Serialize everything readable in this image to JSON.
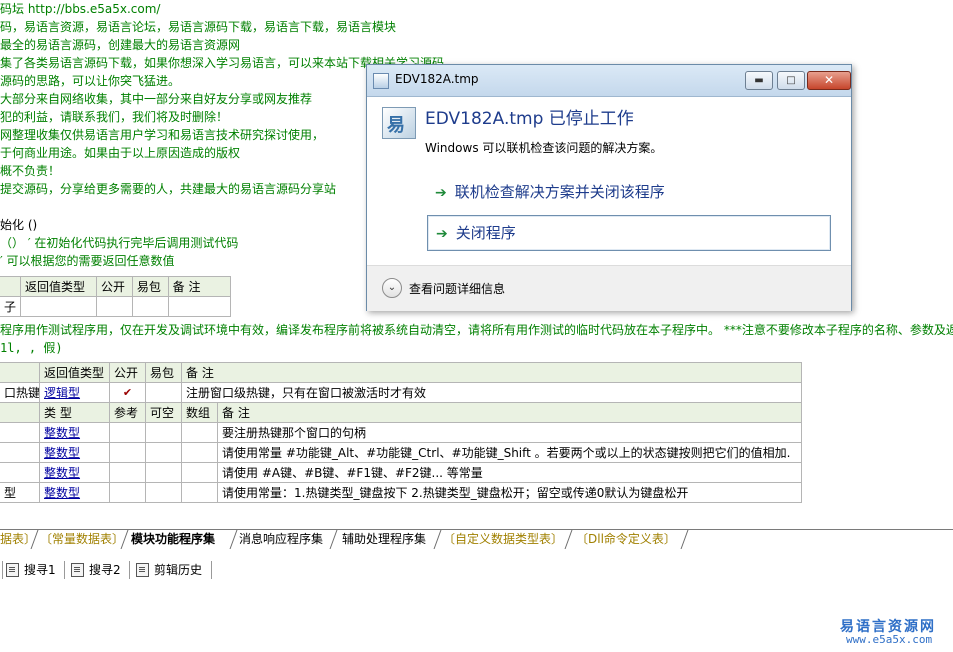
{
  "code_lines": [
    {
      "text": "码坛 http://bbs.e5a5x.com/",
      "color": "green"
    },
    {
      "text": "码，易语言资源，易语言论坛，易语言源码下载，易语言下载，易语言模块",
      "color": "green"
    },
    {
      "text": "最全的易语言源码，创建最大的易语言资源网",
      "color": "green"
    },
    {
      "text": "集了各类易语言源码下载，如果你想深入学习易语言，可以来本站下载相关学习源码",
      "color": "green"
    },
    {
      "text": "源码的思路，可以让你突飞猛进。",
      "color": "green"
    },
    {
      "text": "大部分来自网络收集，其中一部分来自好友分享或网友推荐",
      "color": "green"
    },
    {
      "text": "犯的利益，请联系我们，我们将及时删除！",
      "color": "green"
    },
    {
      "text": "网整理收集仅供易语言用户学习和易语言技术研究探讨使用，",
      "color": "green"
    },
    {
      "text": "于何商业用途。如果由于以上原因造成的版权",
      "color": "green"
    },
    {
      "text": "概不负责！",
      "color": "green"
    },
    {
      "text": "提交源码，分享给更多需要的人，共建最大的易语言源码分享站",
      "color": "green"
    },
    {
      "text": "",
      "color": "green"
    },
    {
      "text": "始化 ()",
      "color": "green"
    },
    {
      "text": "（）  ′ 在初始化代码执行完毕后调用测试代码",
      "color": "green"
    },
    {
      "text": "′ 可以根据您的需要返回任意数值",
      "color": "green"
    }
  ],
  "table1": {
    "headers": [
      "",
      "返回值类型",
      "公开",
      "易包",
      "备 注"
    ],
    "row": [
      "子",
      "",
      "",
      "",
      ""
    ]
  },
  "note_line": "程序用作测试程序用，仅在开发及调试环境中有效，编译发布程序前将被系统自动清空，请将所有用作测试的临时代码放在本子程序中。 ***注意不要修改本子程序的名称、参数及返回",
  "note_line2": "1l, , 假)",
  "table2": {
    "header": [
      "",
      "返回值类型",
      "公开",
      "易包",
      "备 注"
    ],
    "func_row": [
      "口热键",
      "逻辑型",
      "✔",
      "",
      "注册窗口级热键，只有在窗口被激活时才有效"
    ],
    "param_header": [
      "",
      "类 型",
      "参考",
      "可空",
      "数组",
      "备 注"
    ],
    "params": [
      [
        "",
        "整数型",
        "",
        "",
        "",
        "要注册热键那个窗口的句柄"
      ],
      [
        "",
        "整数型",
        "",
        "",
        "",
        "请使用常量 #功能键_Alt、#功能键_Ctrl、#功能键_Shift 。若要两个或以上的状态键按则把它们的值相加."
      ],
      [
        "",
        "整数型",
        "",
        "",
        "",
        "请使用 #A键、#B键、#F1键、#F2键... 等常量"
      ],
      [
        "型",
        "整数型",
        "",
        "",
        "",
        "请使用常量：1.热键类型_键盘按下 2.热键类型_键盘松开；留空或传递0默认为键盘松开"
      ]
    ]
  },
  "tabs": [
    {
      "label": "据表〕",
      "style": "gold"
    },
    {
      "label": "〔常量数据表〕",
      "style": "gold"
    },
    {
      "label": "模块功能程序集",
      "style": "active"
    },
    {
      "label": "消息响应程序集",
      "style": "normal"
    },
    {
      "label": "辅助处理程序集",
      "style": "normal"
    },
    {
      "label": "〔自定义数据类型表〕",
      "style": "gold"
    },
    {
      "label": "〔Dll命令定义表〕",
      "style": "gold"
    }
  ],
  "bottom_bar": [
    {
      "label": "搜寻1"
    },
    {
      "label": "搜寻2"
    },
    {
      "label": "剪辑历史"
    }
  ],
  "watermark": {
    "title": "易语言资源网",
    "url": "www.e5a5x.com"
  },
  "dialog": {
    "title": "EDV182A.tmp",
    "heading": "EDV182A.tmp 已停止工作",
    "message": "Windows 可以联机检查该问题的解决方案。",
    "options": [
      {
        "label": "联机检查解决方案并关闭该程序",
        "selected": false
      },
      {
        "label": "关闭程序",
        "selected": true
      }
    ],
    "details_label": "查看问题详细信息",
    "app_icon_glyph": "易",
    "minimize_glyph": "▬",
    "maximize_glyph": "□",
    "close_glyph": "✕",
    "details_glyph": "⌄"
  },
  "colors": {
    "code_green": "#008000",
    "link_blue": "#0000a0",
    "gold": "#a08000",
    "dialog_heading": "#1e3c8c",
    "arrow_green": "#1f8a3a"
  }
}
